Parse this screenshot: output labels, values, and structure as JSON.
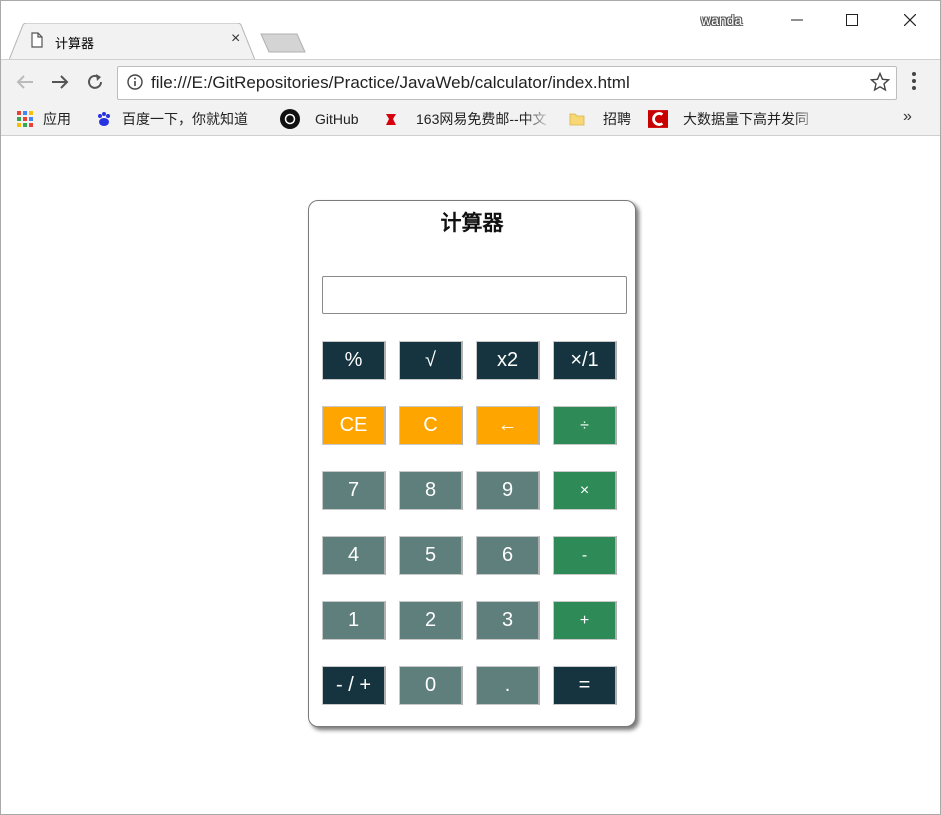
{
  "window": {
    "user": "wanda",
    "tab_title": "计算器",
    "controls": {
      "minimize": "—",
      "maximize": "☐",
      "close": "✕"
    }
  },
  "toolbar": {
    "url": "file:///E:/GitRepositories/Practice/JavaWeb/calculator/index.html"
  },
  "bookmarks": [
    {
      "label": "应用",
      "icon": "apps-grid-icon"
    },
    {
      "label": "百度一下，你就知道",
      "icon": "baidu-paw-icon"
    },
    {
      "label": "GitHub",
      "icon": "github-icon"
    },
    {
      "label": "163网易免费邮--中文",
      "icon": "netease-mail-icon"
    },
    {
      "label": "招聘",
      "icon": "folder-icon"
    },
    {
      "label": "大数据量下高并发同",
      "icon": "csdn-icon"
    }
  ],
  "bookmarks_more": "»",
  "calculator": {
    "title": "计算器",
    "display_value": "",
    "rows": [
      [
        {
          "label": "%",
          "style": "dark"
        },
        {
          "label": "√",
          "style": "dark"
        },
        {
          "label": "x2",
          "style": "dark"
        },
        {
          "label": "×/1",
          "style": "dark"
        }
      ],
      [
        {
          "label": "CE",
          "style": "orange"
        },
        {
          "label": "C",
          "style": "orange"
        },
        {
          "label": "←",
          "style": "orange"
        },
        {
          "label": "÷",
          "style": "green"
        }
      ],
      [
        {
          "label": "7",
          "style": "gray"
        },
        {
          "label": "8",
          "style": "gray"
        },
        {
          "label": "9",
          "style": "gray"
        },
        {
          "label": "×",
          "style": "green"
        }
      ],
      [
        {
          "label": "4",
          "style": "gray"
        },
        {
          "label": "5",
          "style": "gray"
        },
        {
          "label": "6",
          "style": "gray"
        },
        {
          "label": "-",
          "style": "green"
        }
      ],
      [
        {
          "label": "1",
          "style": "gray"
        },
        {
          "label": "2",
          "style": "gray"
        },
        {
          "label": "3",
          "style": "gray"
        },
        {
          "label": "+",
          "style": "green"
        }
      ],
      [
        {
          "label": "- / +",
          "style": "dark"
        },
        {
          "label": "0",
          "style": "gray"
        },
        {
          "label": ".",
          "style": "gray"
        },
        {
          "label": "=",
          "style": "dark"
        }
      ]
    ],
    "colors": {
      "dark": "#15343f",
      "orange": "#ffa500",
      "green": "#2e8b57",
      "gray": "#5f7f7c"
    }
  }
}
